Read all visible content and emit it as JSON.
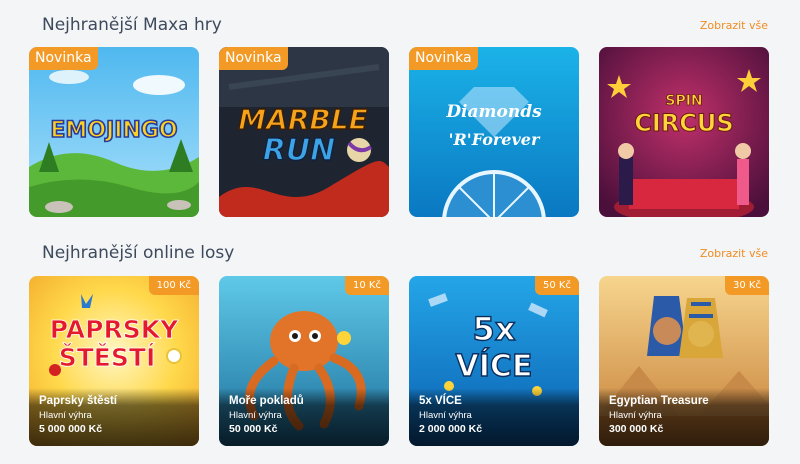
{
  "games_section": {
    "title": "Nejhranější Maxa hry",
    "show_all": "Zobrazit vše",
    "items": [
      {
        "title": "EMOJINGO",
        "badge": "Novinka"
      },
      {
        "title": "MARBLE RUN",
        "badge": "Novinka"
      },
      {
        "title": "Diamonds 'R' Forever",
        "badge": "Novinka"
      },
      {
        "title": "SPIN CIRCUS",
        "badge": ""
      }
    ]
  },
  "tickets_section": {
    "title": "Nejhranější online losy",
    "show_all": "Zobrazit vše",
    "prize_label": "Hlavní výhra",
    "items": [
      {
        "art_line1": "PAPRSKY",
        "art_line2": "ŠTĚSTÍ",
        "price": "100 Kč",
        "name": "Paprsky štěstí",
        "prize": "5 000 000 Kč"
      },
      {
        "price": "10 Kč",
        "name": "Moře pokladů",
        "prize": "50 000 Kč"
      },
      {
        "art_line1": "5x",
        "art_line2": "VÍCE",
        "price": "50 Kč",
        "name": "5x VÍCE",
        "prize": "2 000 000 Kč"
      },
      {
        "price": "30 Kč",
        "name": "Egyptian Treasure",
        "prize": "300 000 Kč"
      }
    ]
  },
  "colors": {
    "accent": "#f39a26",
    "link": "#f08c1f",
    "title": "#3d4a5c",
    "background": "#f4f5f7"
  }
}
